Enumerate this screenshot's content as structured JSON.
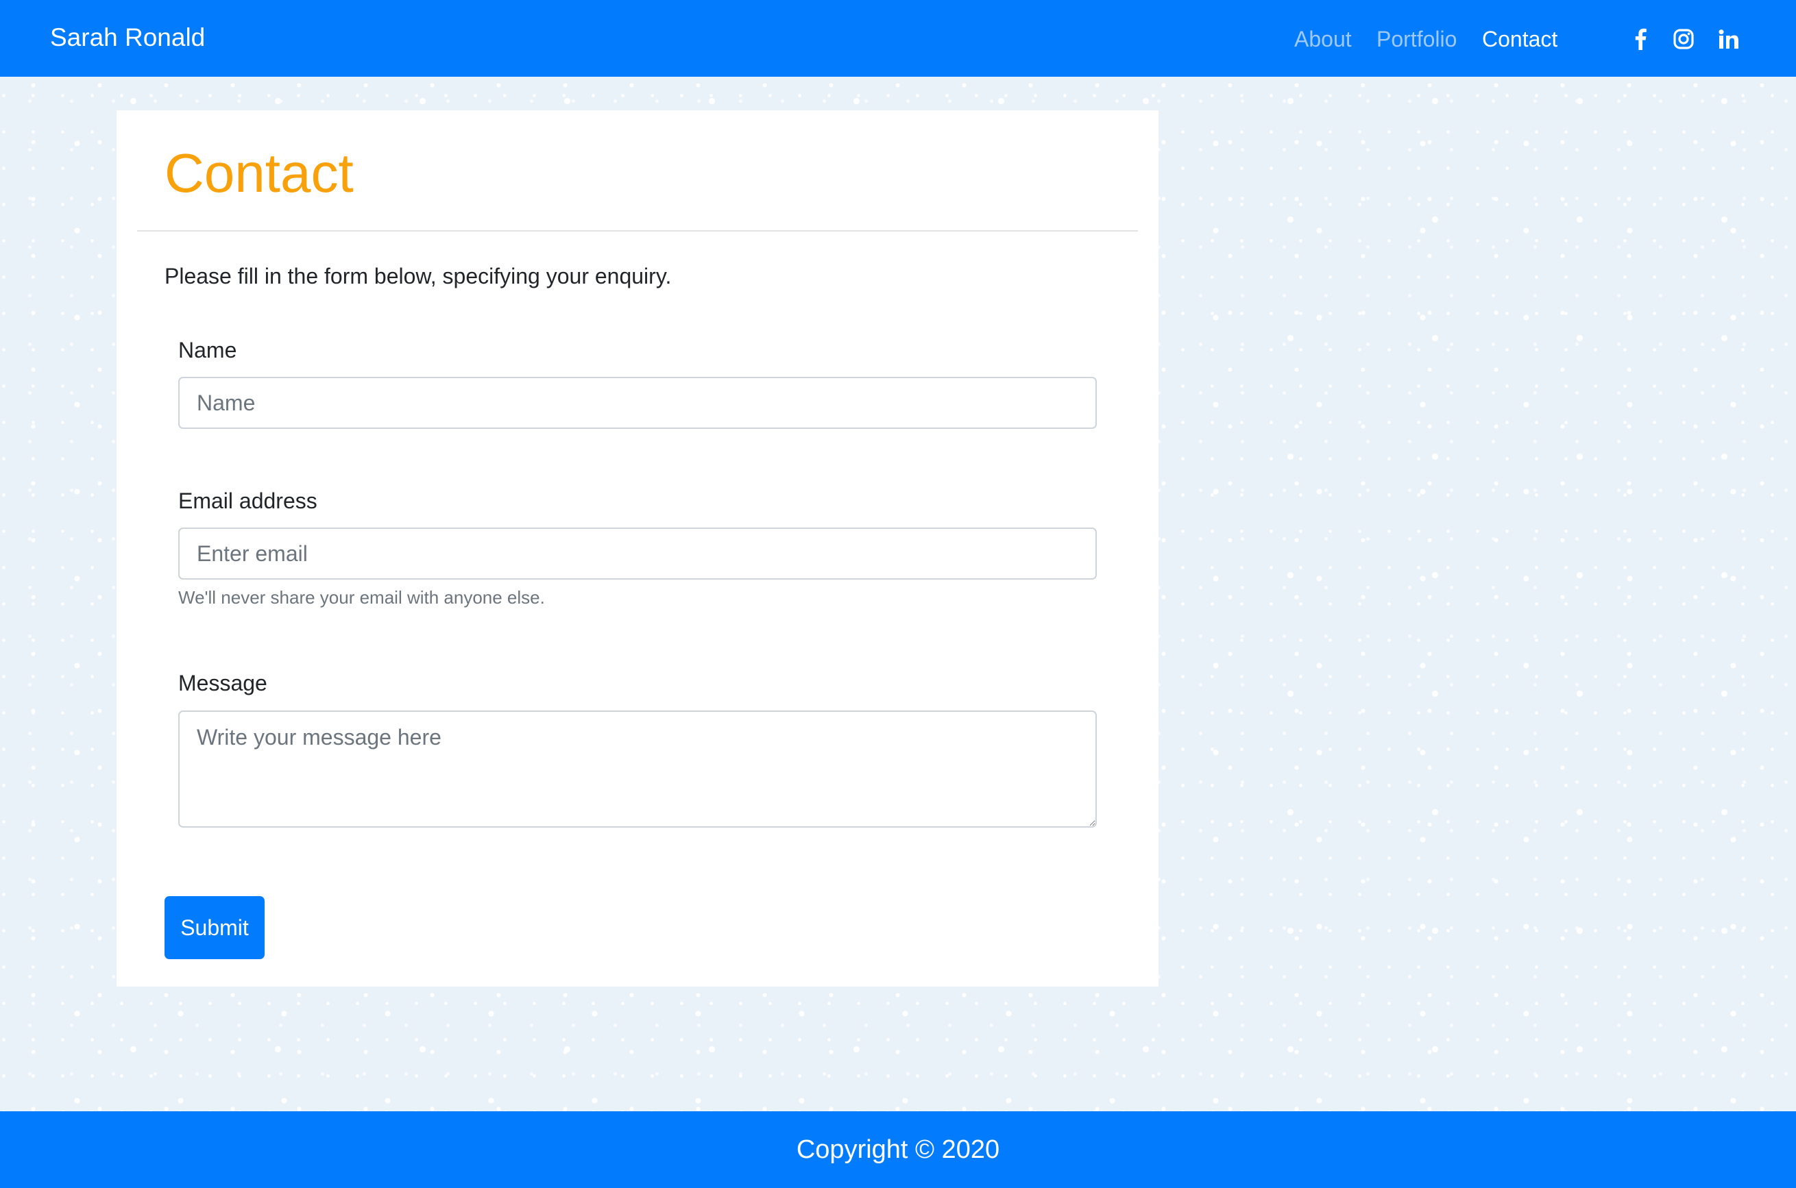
{
  "header": {
    "brand": "Sarah Ronald",
    "nav": [
      {
        "label": "About"
      },
      {
        "label": "Portfolio"
      },
      {
        "label": "Contact",
        "active": true
      }
    ],
    "social_icons": [
      "facebook-icon",
      "instagram-icon",
      "linkedin-icon"
    ]
  },
  "contact": {
    "title": "Contact",
    "intro": "Please fill in the form below, specifying your enquiry.",
    "name": {
      "label": "Name",
      "placeholder": "Name",
      "value": ""
    },
    "email": {
      "label": "Email address",
      "placeholder": "Enter email",
      "value": "",
      "help": "We'll never share your email with anyone else."
    },
    "message": {
      "label": "Message",
      "placeholder": "Write your message here",
      "value": ""
    },
    "submit_label": "Submit"
  },
  "footer": {
    "copyright": "Copyright © 2020"
  },
  "colors": {
    "brand_blue": "#027bfc",
    "title_orange": "#f8a10a",
    "nav_inactive": "#9fc9fb",
    "page_background": "#eaf2f9"
  }
}
